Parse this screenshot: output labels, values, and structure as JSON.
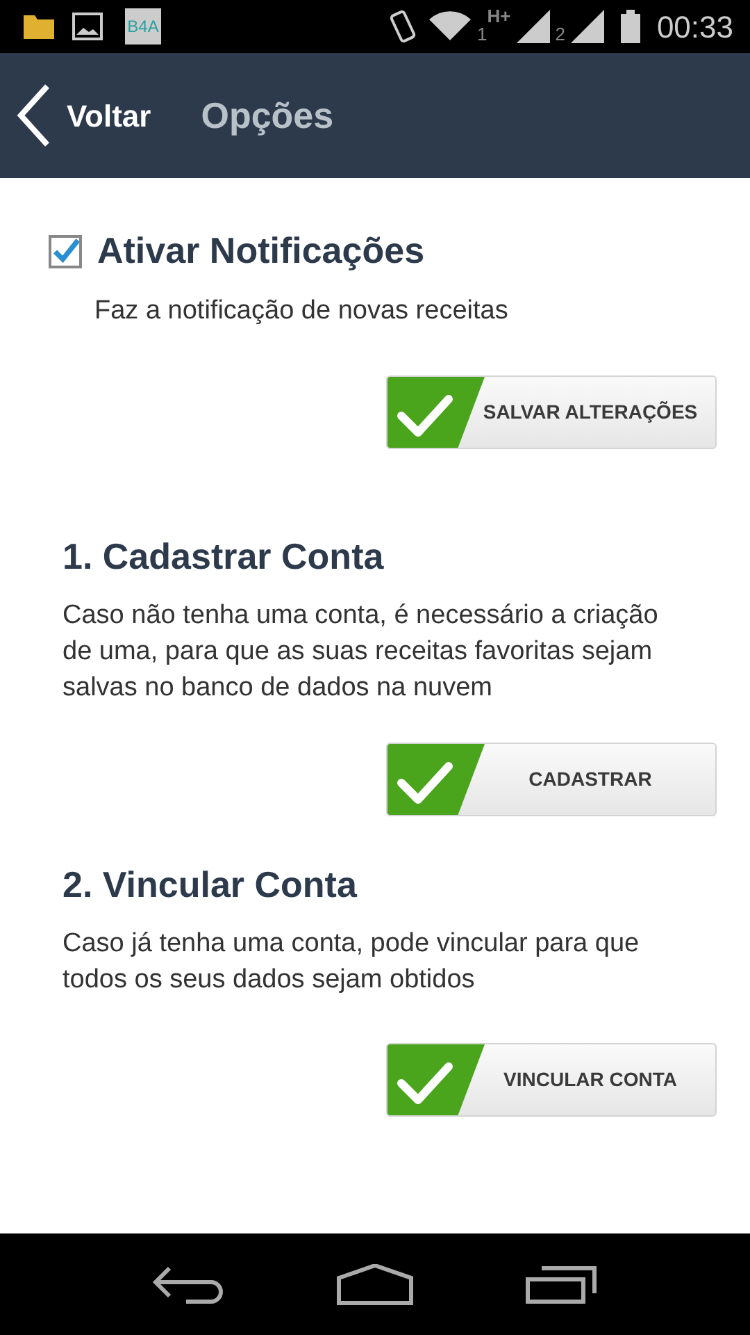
{
  "status_bar": {
    "app_icon_text": "B4A",
    "sim1": "1",
    "network": "H+",
    "sim2": "2",
    "time": "00:33"
  },
  "header": {
    "back": "Voltar",
    "title": "Opções"
  },
  "notifications": {
    "label": "Ativar Notificações",
    "checked": true,
    "description": "Faz a notificação de novas receitas",
    "button": "SALVAR ALTERAÇÕES"
  },
  "sections": [
    {
      "title": "1. Cadastrar Conta",
      "text": "Caso não tenha uma conta, é necessário a criação de uma, para que as suas receitas favoritas sejam salvas no banco de dados na nuvem",
      "button": "CADASTRAR"
    },
    {
      "title": "2. Vincular Conta",
      "text": "Caso já tenha uma conta, pode vincular para que todos os seus dados sejam obtidos",
      "button": "VINCULAR CONTA"
    }
  ]
}
